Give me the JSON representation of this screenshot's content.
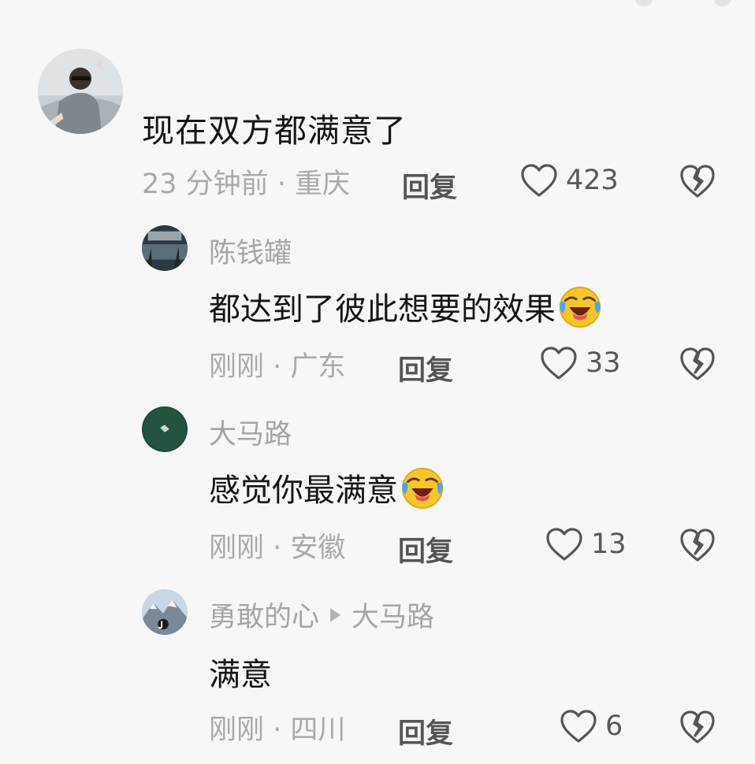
{
  "main_comment": {
    "text": "现在双方都满意了",
    "time_location": "23 分钟前 · 重庆",
    "reply_label": "回复",
    "like_count": "423"
  },
  "replies": [
    {
      "username": "陈钱罐",
      "text": "都达到了彼此想要的效果",
      "emoji": "laughing-crying-emoji",
      "time_location": "刚刚 · 广东",
      "reply_label": "回复",
      "like_count": "33"
    },
    {
      "username": "大马路",
      "text": "感觉你最满意",
      "emoji": "laughing-crying-emoji",
      "time_location": "刚刚 · 安徽",
      "reply_label": "回复",
      "like_count": "13"
    },
    {
      "username": "勇敢的心",
      "reply_to": "大马路",
      "text": "满意",
      "time_location": "刚刚 · 四川",
      "reply_label": "回复",
      "like_count": "6"
    }
  ],
  "icons": {
    "like": "heart-outline-icon",
    "dislike": "broken-heart-icon"
  },
  "colors": {
    "background": "#f7f7f7",
    "muted_text": "#a9a9a9",
    "action_text": "#555555"
  }
}
